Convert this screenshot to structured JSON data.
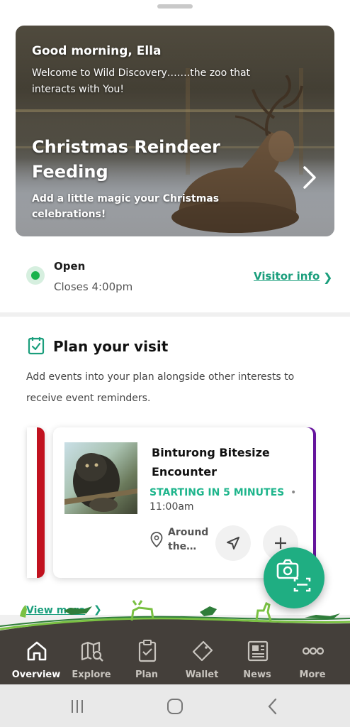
{
  "hero": {
    "greeting": "Good morning, Ella",
    "welcome": "Welcome to Wild Discovery…….the zoo that interacts with You!",
    "title": "Christmas Reindeer Feeding",
    "subtitle": "Add a little magic your Christmas celebrations!",
    "next_icon": "chevron-right-icon"
  },
  "status": {
    "open_label": "Open",
    "closes_label": "Closes 4:00pm",
    "visitor_info_label": "Visitor info",
    "status_color": "#19b24b"
  },
  "plan": {
    "title": "Plan your visit",
    "description": "Add events into your plan alongside other interests to receive event reminders.",
    "icon": "calendar-check-icon",
    "view_more_label": "View more"
  },
  "event": {
    "title": "Binturong Bitesize Encounter",
    "status": "STARTING IN 5 MINUTES",
    "separator": "•",
    "time": "11:00am",
    "location": "Around the…",
    "status_color": "#1fb58c"
  },
  "nav": {
    "items": [
      {
        "label": "Overview",
        "icon": "home-icon",
        "active": true
      },
      {
        "label": "Explore",
        "icon": "map-search-icon",
        "active": false
      },
      {
        "label": "Plan",
        "icon": "clipboard-check-icon",
        "active": false
      },
      {
        "label": "Wallet",
        "icon": "ticket-icon",
        "active": false
      },
      {
        "label": "News",
        "icon": "newspaper-icon",
        "active": false
      },
      {
        "label": "More",
        "icon": "more-dots-icon",
        "active": false
      }
    ]
  },
  "colors": {
    "accent": "#1a9e7c",
    "fab": "#1fae82",
    "nav_bg": "#443f3a",
    "card_left_stripe": "#c1121f",
    "card_right_stripe": "#6a15a5"
  }
}
